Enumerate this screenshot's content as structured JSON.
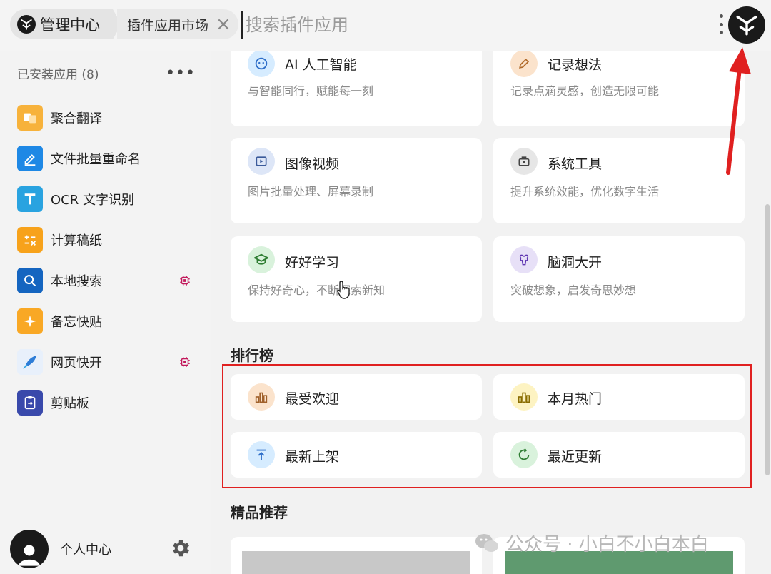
{
  "header": {
    "root_label": "管理中心",
    "tab_label": "插件应用市场",
    "search_placeholder": "搜索插件应用"
  },
  "sidebar": {
    "heading": "已安装应用 (8)",
    "more": "•••",
    "items": [
      {
        "label": "聚合翻译",
        "icon": "translate-icon",
        "color": "#f7b23b"
      },
      {
        "label": "文件批量重命名",
        "icon": "pen-edit-icon",
        "color": "#1e88e5"
      },
      {
        "label": "OCR 文字识别",
        "icon": "ocr-icon",
        "color": "#29a3e0"
      },
      {
        "label": "计算稿纸",
        "icon": "calculator-icon",
        "color": "#f7a21b"
      },
      {
        "label": "本地搜索",
        "icon": "search-icon",
        "color": "#1565c0",
        "badge": true
      },
      {
        "label": "备忘快贴",
        "icon": "sticky-note-icon",
        "color": "#f9a825"
      },
      {
        "label": "网页快开",
        "icon": "rocket-icon",
        "color": "#2e7dd7",
        "badge": true
      },
      {
        "label": "剪贴板",
        "icon": "clipboard-icon",
        "color": "#3949ab"
      }
    ],
    "footer_label": "个人中心"
  },
  "categories": [
    {
      "title": "AI 人工智能",
      "desc": "与智能同行，赋能每一刻",
      "icon": "robot-icon",
      "color": "#d6ecff"
    },
    {
      "title": "记录想法",
      "desc": "记录点滴灵感，创造无限可能",
      "icon": "pencil-icon",
      "color": "#fbe3cc"
    },
    {
      "title": "图像视频",
      "desc": "图片批量处理、屏幕录制",
      "icon": "video-play-icon",
      "color": "#dde6f7"
    },
    {
      "title": "系统工具",
      "desc": "提升系统效能，优化数字生活",
      "icon": "toolbox-icon",
      "color": "#e6e6e6"
    },
    {
      "title": "好好学习",
      "desc": "保持好奇心，不断探索新知",
      "icon": "graduation-cap-icon",
      "color": "#d9f2dc"
    },
    {
      "title": "脑洞大开",
      "desc": "突破想象，启发奇思妙想",
      "icon": "brain-icon",
      "color": "#e7e0f7"
    }
  ],
  "ranking": {
    "title": "排行榜",
    "items": [
      {
        "title": "最受欢迎",
        "icon": "bar-chart-icon",
        "color": "#fbe3cc"
      },
      {
        "title": "本月热门",
        "icon": "bar-chart-icon",
        "color": "#fdf3c2"
      },
      {
        "title": "最新上架",
        "icon": "upload-icon",
        "color": "#d6ecff"
      },
      {
        "title": "最近更新",
        "icon": "refresh-icon",
        "color": "#d9f2dc"
      }
    ]
  },
  "featured": {
    "title": "精品推荐"
  },
  "watermark": "公众号 · 小白不小白本白"
}
